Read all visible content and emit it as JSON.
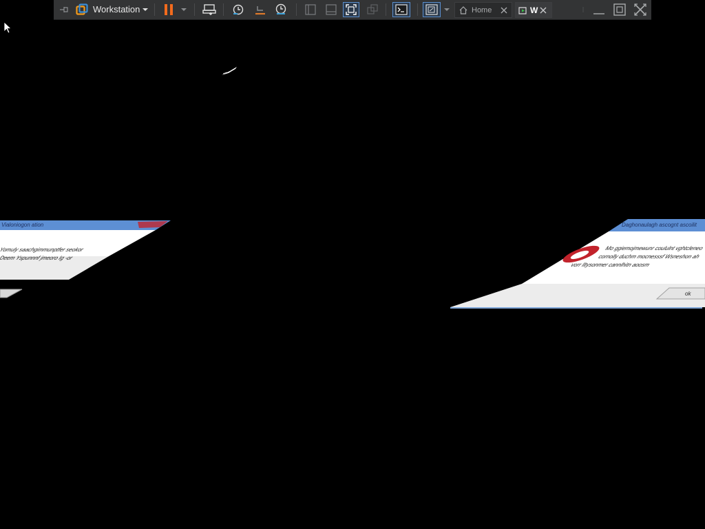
{
  "toolbar": {
    "app_name": "Workstation",
    "tabs": [
      {
        "label": "Home",
        "active": false
      },
      {
        "label": "W",
        "active": true
      }
    ]
  },
  "colors": {
    "background": "#000000",
    "toolbar_bg": "#333435",
    "pause_accent": "#f26b1d",
    "vmware_logo_orange": "#f39a1b",
    "vmware_logo_blue": "#3a8ed6",
    "snapshot_blue": "#3aa0d8",
    "revert_orange": "#e07a2a",
    "dialog_title_blue": "#5d8fd4",
    "dialog_body": "#ffffff",
    "dialog_footer": "#ededed",
    "error_red": "#c2232c"
  },
  "icons": {
    "pin": "pin-icon",
    "logo": "vmware-logo-icon",
    "dropdown": "chevron-down-icon",
    "pause": "pause-icon",
    "send_keys": "send-ctrl-alt-del-icon",
    "snapshot": "take-snapshot-icon",
    "revert": "revert-snapshot-icon",
    "snapshot_manager": "snapshot-manager-icon",
    "library": "library-icon",
    "thumbnail": "thumbnail-bar-icon",
    "fullscreen": "fullscreen-icon",
    "unity": "unity-icon",
    "console": "console-view-icon",
    "stretch": "stretch-guest-icon",
    "home": "home-icon",
    "vm_tab": "vm-tab-icon",
    "close": "close-icon",
    "minimize": "minimize-icon",
    "restore": "restore-icon",
    "exit": "exit-fullscreen-icon"
  },
  "dialogs": {
    "left": {
      "title": "Vialoniogon ation",
      "line1": "Yomuly saachgimmunptfer seokor",
      "line2": "Deem Yspunnnf jmeoro Ig -or"
    },
    "right": {
      "title": "Daghonaulagh ascognt ascoilit",
      "line1": "Mo ggiemojmewunr coululnt vghtcleneo",
      "line2": "cornolly duchm mocnesssf Wsneshon ah",
      "line3": "vorr lltysonmer cannlhitn aoosm",
      "ok_label": "ok"
    }
  }
}
